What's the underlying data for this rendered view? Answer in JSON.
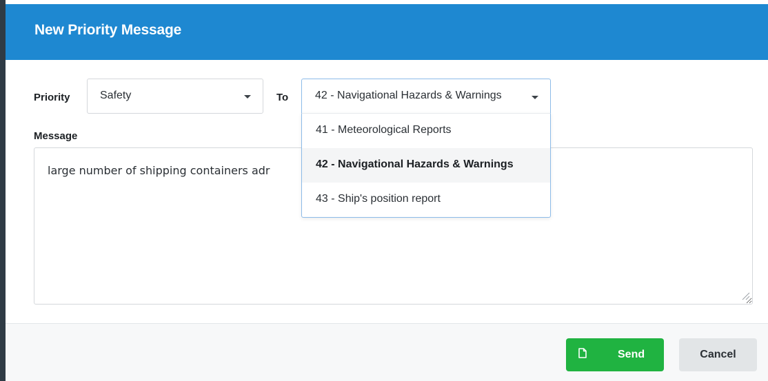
{
  "dialog": {
    "title": "New Priority Message"
  },
  "form": {
    "priority_label": "Priority",
    "priority_value": "Safety",
    "to_label": "To",
    "to_value": "42 - Navigational Hazards & Warnings",
    "message_label": "Message",
    "message_value": "large number of shipping containers adr"
  },
  "to_dropdown": {
    "options": [
      {
        "label": "41 - Meteorological Reports",
        "selected": false
      },
      {
        "label": "42 - Navigational Hazards & Warnings",
        "selected": true
      },
      {
        "label": "43 - Ship's position report",
        "selected": false
      }
    ]
  },
  "footer": {
    "send_label": "Send",
    "cancel_label": "Cancel"
  },
  "icons": {
    "send": "document-icon",
    "select_caret": "caret-down-icon"
  },
  "colors": {
    "header": "#1e88d1",
    "send": "#20b341",
    "cancel": "#e2e5e7"
  }
}
